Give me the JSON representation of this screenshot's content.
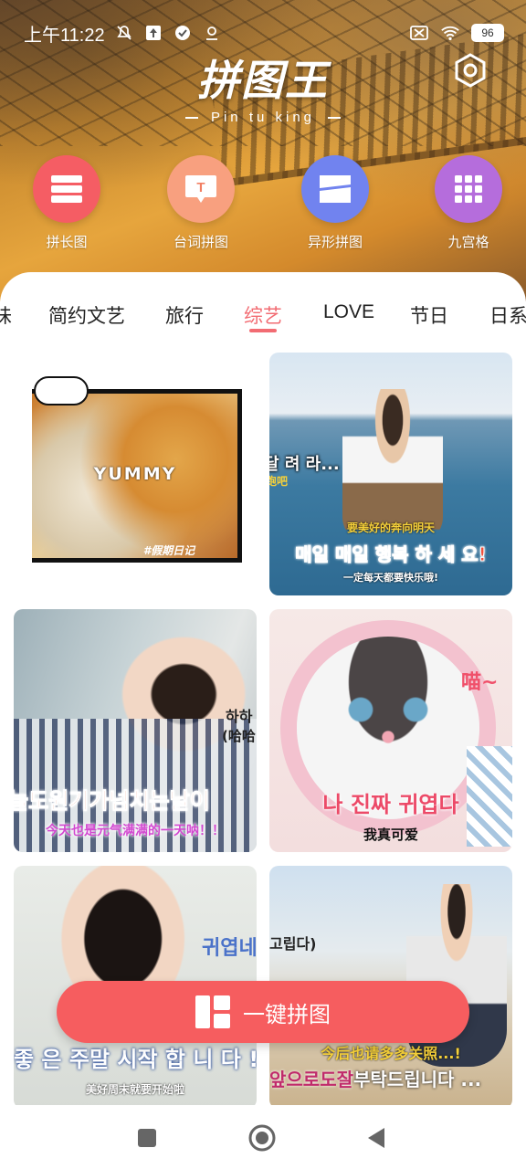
{
  "status_bar": {
    "time": "上午11:22",
    "battery": "96",
    "left_icons": [
      "mute-icon",
      "upload-icon",
      "check-circle-icon",
      "location-icon"
    ],
    "right_icons": [
      "sim-off-icon",
      "wifi-icon",
      "battery-icon"
    ]
  },
  "header": {
    "logo_title": "拼图王",
    "logo_subtitle": "Pin tu king",
    "settings_icon": "hexagon-gear-icon"
  },
  "tools": [
    {
      "label": "拼长图",
      "icon": "stack-rows-icon",
      "color": "#f55d64"
    },
    {
      "label": "台词拼图",
      "icon": "text-bubble-icon",
      "color": "#f8a07f"
    },
    {
      "label": "异形拼图",
      "icon": "slanted-split-icon",
      "color": "#7183ef"
    },
    {
      "label": "九宫格",
      "icon": "grid-nine-icon",
      "color": "#b56ddc"
    }
  ],
  "tabs": {
    "items": [
      "味",
      "简约文艺",
      "旅行",
      "综艺",
      "LOVE",
      "节日",
      "日系"
    ],
    "active": "综艺"
  },
  "cards": {
    "card1": {
      "caption_main": "YUMMY",
      "caption_tag": "#假期日记"
    },
    "card2": {
      "caption_top": "달 려 라...",
      "caption_top_small": "跑吧",
      "caption_small": "要美好的奔向明天",
      "caption_main": "매일 매일 행복 하 세 요!",
      "caption_bottom": "一定每天都要快乐哦!"
    },
    "card3": {
      "caption_side": "하하",
      "caption_side_small": "(哈哈",
      "caption_main": "늘도원기가넘치는날이",
      "caption_sub": "今天也是元气满满的一天呐！！"
    },
    "card4": {
      "caption_corner": "喵~",
      "caption_main": "나 진짜 귀엽다",
      "caption_sub": "我真可爱"
    },
    "card5": {
      "caption_side": "귀엽네",
      "caption_main": "좋 은 주말 시작 합 니 다 !",
      "caption_sub": "美好周末就要开始啦"
    },
    "card6": {
      "caption_top": "고립다)",
      "caption_mid": "今后也请多多关照...!",
      "caption_main_red": "앞으로도잘",
      "caption_main_white": "부탁드립니다 ..."
    }
  },
  "action": {
    "label": "一键拼图",
    "icon": "collage-layout-icon"
  },
  "nav": {
    "icons": [
      "square-recents-icon",
      "circle-home-icon",
      "triangle-back-icon"
    ]
  }
}
